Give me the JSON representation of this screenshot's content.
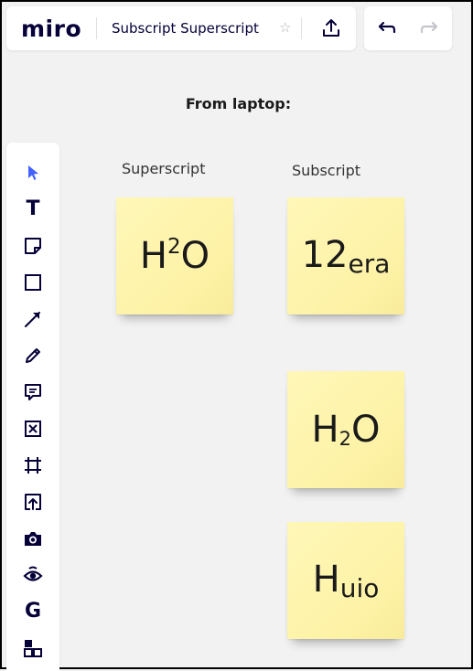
{
  "header": {
    "logo_text": "miro",
    "board_title": "Subscript Superscript",
    "star_glyph": "☆",
    "icons": [
      "export-icon",
      "undo-icon",
      "redo-icon",
      "star-icon"
    ]
  },
  "toolbar": {
    "tools": [
      {
        "name": "select-tool",
        "icon": "cursor-icon"
      },
      {
        "name": "text-tool",
        "icon": "text-icon",
        "glyph": "T"
      },
      {
        "name": "sticky-note-tool",
        "icon": "sticky-note-icon"
      },
      {
        "name": "shape-tool",
        "icon": "square-icon"
      },
      {
        "name": "connection-line-tool",
        "icon": "arrow-icon"
      },
      {
        "name": "pen-tool",
        "icon": "pen-icon"
      },
      {
        "name": "comment-tool",
        "icon": "comment-icon"
      },
      {
        "name": "template-tool",
        "icon": "cross-box-icon"
      },
      {
        "name": "frame-tool",
        "icon": "frame-icon"
      },
      {
        "name": "upload-tool",
        "icon": "upload-icon"
      },
      {
        "name": "camera-tool",
        "icon": "camera-icon"
      },
      {
        "name": "eye-app-tool",
        "icon": "eye-icon"
      },
      {
        "name": "google-app-tool",
        "icon": "google-icon",
        "glyph": "G"
      },
      {
        "name": "more-apps-tool",
        "icon": "apps-icon"
      }
    ]
  },
  "canvas": {
    "heading": "From laptop:",
    "superscript_label": "Superscript",
    "subscript_label": "Subscript",
    "notes": {
      "h2o_sup": {
        "main": "H",
        "script": "2",
        "after": "O"
      },
      "era_sub": {
        "main": "12",
        "script": "era",
        "after": ""
      },
      "h2o_sub": {
        "main": "H",
        "script": "2",
        "after": "O"
      },
      "huio_sub": {
        "main": "H",
        "script": "uio",
        "after": ""
      }
    }
  },
  "colors": {
    "brand": "#050038",
    "sticky_note": "#fdf2a6",
    "select_active": "#4262ff",
    "canvas_bg": "#f2f2f2"
  }
}
